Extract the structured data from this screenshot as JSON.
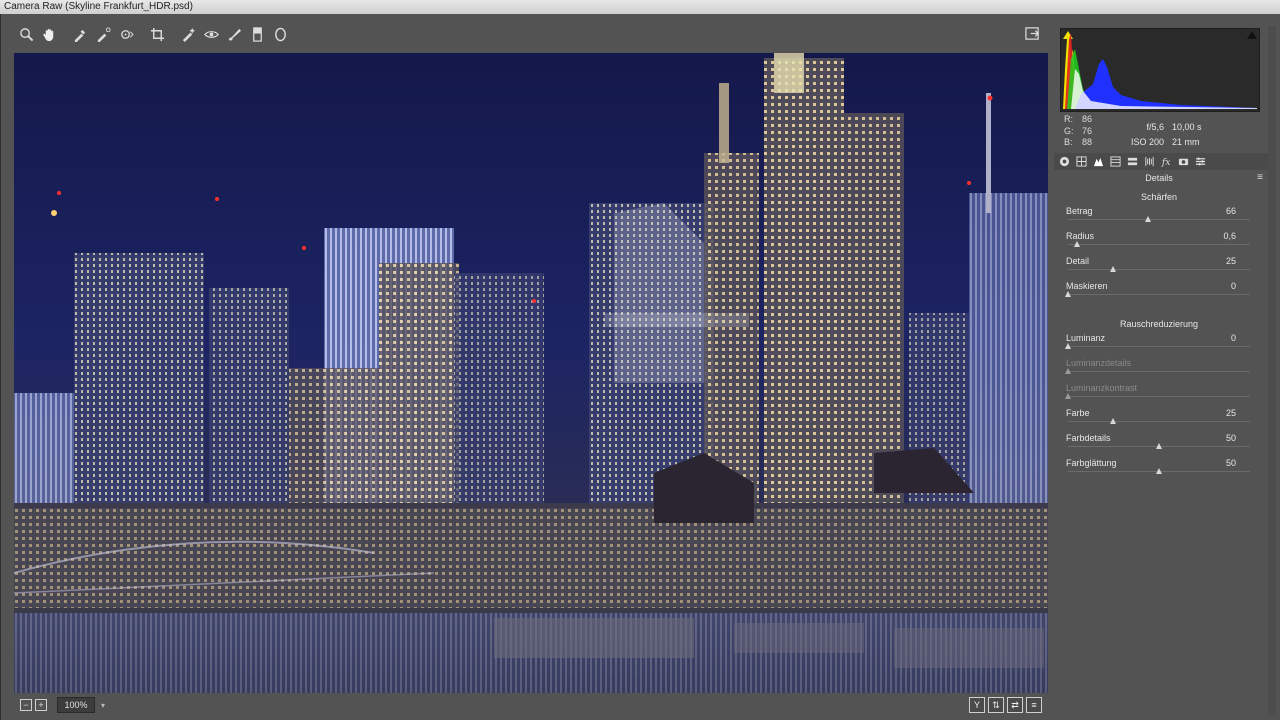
{
  "window": {
    "title": "Camera Raw (Skyline Frankfurt_HDR.psd)"
  },
  "toolbar": {
    "tools": [
      {
        "name": "zoom-tool-icon"
      },
      {
        "name": "hand-tool-icon"
      },
      {
        "name": "white-balance-tool-icon"
      },
      {
        "name": "color-sampler-tool-icon"
      },
      {
        "name": "targeted-adjustment-tool-icon"
      },
      {
        "name": "crop-tool-icon"
      },
      {
        "name": "straighten-tool-icon"
      },
      {
        "name": "spot-removal-tool-icon"
      },
      {
        "name": "red-eye-removal-icon"
      },
      {
        "name": "adjustment-brush-icon"
      },
      {
        "name": "graduated-filter-icon"
      },
      {
        "name": "radial-filter-icon"
      }
    ]
  },
  "zoom": {
    "value": "100%"
  },
  "readout": {
    "r_label": "R:",
    "r_value": "86",
    "g_label": "G:",
    "g_value": "76",
    "b_label": "B:",
    "b_value": "88"
  },
  "exif": {
    "aperture": "f/5,6",
    "shutter": "10,00 s",
    "iso": "ISO 200",
    "focal": "21 mm"
  },
  "panel": {
    "title": "Details",
    "sharpen_heading": "Schärfen",
    "noise_heading": "Rauschreduzierung",
    "sharpen_sliders": [
      {
        "label": "Betrag",
        "value": "66",
        "pct": 0.44,
        "disabled": false
      },
      {
        "label": "Radius",
        "value": "0,6",
        "pct": 0.05,
        "disabled": false
      },
      {
        "label": "Detail",
        "value": "25",
        "pct": 0.25,
        "disabled": false
      },
      {
        "label": "Maskieren",
        "value": "0",
        "pct": 0.0,
        "disabled": false
      }
    ],
    "noise_sliders": [
      {
        "label": "Luminanz",
        "value": "0",
        "pct": 0.0,
        "disabled": false
      },
      {
        "label": "Luminanzdetails",
        "value": "",
        "pct": 0.0,
        "disabled": true
      },
      {
        "label": "Luminanzkontrast",
        "value": "",
        "pct": 0.0,
        "disabled": true
      },
      {
        "label": "Farbe",
        "value": "25",
        "pct": 0.25,
        "disabled": false
      },
      {
        "label": "Farbdetails",
        "value": "50",
        "pct": 0.5,
        "disabled": false
      },
      {
        "label": "Farbglättung",
        "value": "50",
        "pct": 0.5,
        "disabled": false
      }
    ]
  },
  "colors": {
    "accent_yellow": "#f2e100",
    "panel_bg": "#535353",
    "night_sky": "#1a1f4a"
  }
}
